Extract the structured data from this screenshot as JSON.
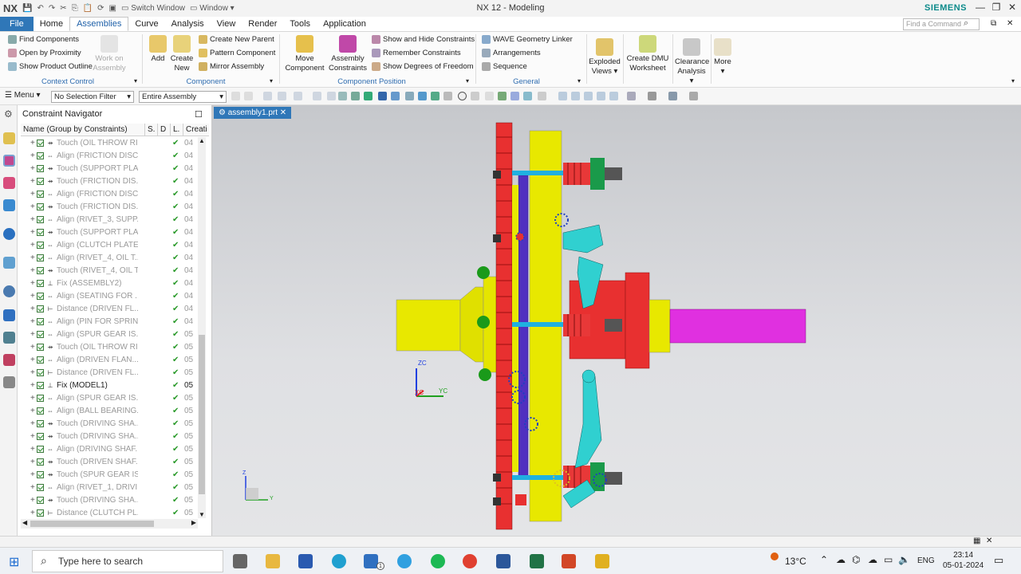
{
  "titlebar": {
    "logo": "NX",
    "switch_window": "Switch Window",
    "window": "Window",
    "title": "NX 12 - Modeling",
    "brand": "SIEMENS",
    "min": "—",
    "restore": "❐",
    "close": "✕",
    "sub_restore": "⧉",
    "sub_close": "✕"
  },
  "menubar": {
    "tabs": [
      "File",
      "Home",
      "Assemblies",
      "Curve",
      "Analysis",
      "View",
      "Render",
      "Tools",
      "Application"
    ],
    "active": "Assemblies",
    "search_placeholder": "Find a Command"
  },
  "ribbon": {
    "context_control": {
      "items": [
        "Find Components",
        "Open by Proximity",
        "Show Product Outline"
      ],
      "work_on": "Work on Assembly",
      "label": "Context Control"
    },
    "component": {
      "add": "Add",
      "create_new": "Create New",
      "items": [
        "Create New Parent",
        "Pattern Component",
        "Mirror Assembly"
      ],
      "label": "Component"
    },
    "component_position": {
      "move": "Move Component",
      "constraints": "Assembly Constraints",
      "items": [
        "Show and Hide Constraints",
        "Remember Constraints",
        "Show Degrees of Freedom"
      ],
      "label": "Component Position"
    },
    "general": {
      "items": [
        "WAVE Geometry Linker",
        "Arrangements",
        "Sequence"
      ],
      "label": "General"
    },
    "extra": {
      "exploded": "Exploded Views",
      "dmu": "Create DMU Worksheet",
      "clearance": "Clearance Analysis",
      "more": "More"
    }
  },
  "selbar": {
    "menu": "Menu",
    "filter": "No Selection Filter",
    "scope": "Entire Assembly"
  },
  "navigator": {
    "title": "Constraint Navigator",
    "columns": [
      "Name (Group by Constraints)",
      "S.",
      "D",
      "L.",
      "Creati"
    ],
    "rows": [
      {
        "name": "Touch (OIL THROW RI...",
        "icon": "touch",
        "created": "04",
        "active": false
      },
      {
        "name": "Align (FRICTION DISC...",
        "icon": "align",
        "created": "04",
        "active": false
      },
      {
        "name": "Touch (SUPPORT PLA...",
        "icon": "touch",
        "created": "04",
        "active": false
      },
      {
        "name": "Touch (FRICTION DIS...",
        "icon": "touch",
        "created": "04",
        "active": false
      },
      {
        "name": "Align (FRICTION DISC...",
        "icon": "align",
        "created": "04",
        "active": false
      },
      {
        "name": "Touch (FRICTION DIS...",
        "icon": "touch",
        "created": "04",
        "active": false
      },
      {
        "name": "Align (RIVET_3, SUPP...",
        "icon": "align",
        "created": "04",
        "active": false
      },
      {
        "name": "Touch (SUPPORT PLA...",
        "icon": "touch",
        "created": "04",
        "active": false
      },
      {
        "name": "Align (CLUTCH PLATE...",
        "icon": "align",
        "created": "04",
        "active": false
      },
      {
        "name": "Align (RIVET_4, OIL T...",
        "icon": "align",
        "created": "04",
        "active": false
      },
      {
        "name": "Touch (RIVET_4, OIL T...",
        "icon": "touch",
        "created": "04",
        "active": false
      },
      {
        "name": "Fix (ASSEMBLY2)",
        "icon": "fix",
        "created": "04",
        "active": false
      },
      {
        "name": "Align (SEATING FOR ...",
        "icon": "align",
        "created": "04",
        "active": false
      },
      {
        "name": "Distance (DRIVEN FL...",
        "icon": "distance",
        "created": "04",
        "active": false
      },
      {
        "name": "Align (PIN FOR SPRIN...",
        "icon": "align",
        "created": "04",
        "active": false
      },
      {
        "name": "Align (SPUR GEAR IS...",
        "icon": "align",
        "created": "05",
        "active": false
      },
      {
        "name": "Touch (OIL THROW RI...",
        "icon": "touch",
        "created": "05",
        "active": false
      },
      {
        "name": "Align (DRIVEN FLAN...",
        "icon": "align",
        "created": "05",
        "active": false
      },
      {
        "name": "Distance (DRIVEN FL...",
        "icon": "distance",
        "created": "05",
        "active": false
      },
      {
        "name": "Fix (MODEL1)",
        "icon": "fix",
        "created": "05",
        "active": true
      },
      {
        "name": "Align (SPUR GEAR IS...",
        "icon": "align",
        "created": "05",
        "active": false
      },
      {
        "name": "Align (BALL BEARING...",
        "icon": "align",
        "created": "05",
        "active": false
      },
      {
        "name": "Touch (DRIVING SHA...",
        "icon": "touch",
        "created": "05",
        "active": false
      },
      {
        "name": "Touch (DRIVING SHA...",
        "icon": "touch",
        "created": "05",
        "active": false
      },
      {
        "name": "Align (DRIVING SHAF...",
        "icon": "align",
        "created": "05",
        "active": false
      },
      {
        "name": "Touch (DRIVEN SHAF...",
        "icon": "touch",
        "created": "05",
        "active": false
      },
      {
        "name": "Touch (SPUR GEAR IS...",
        "icon": "touch",
        "created": "05",
        "active": false
      },
      {
        "name": "Align (RIVET_1, DRIVI...",
        "icon": "align",
        "created": "05",
        "active": false
      },
      {
        "name": "Touch (DRIVING SHA...",
        "icon": "touch",
        "created": "05",
        "active": false
      },
      {
        "name": "Distance (CLUTCH PL...",
        "icon": "distance",
        "created": "05",
        "active": false
      }
    ]
  },
  "viewport": {
    "tab": "assembly1.prt",
    "triad_labels": {
      "zc": "ZC",
      "xc": "XC",
      "yc": "YC",
      "z": "Z",
      "y": "Y"
    }
  },
  "taskbar": {
    "search": "Type here to search",
    "temp": "13°C",
    "lang": "ENG",
    "time": "23:14",
    "date": "05-01-2024",
    "mail_badge": "1"
  }
}
